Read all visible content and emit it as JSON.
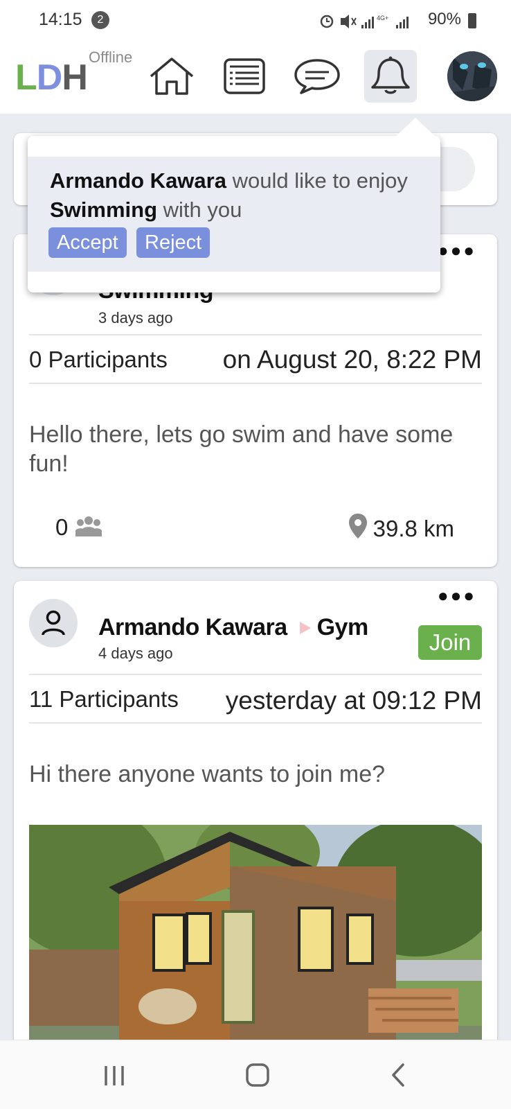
{
  "status_bar": {
    "time": "14:15",
    "notification_count": "2",
    "network": "4G+",
    "battery": "90%"
  },
  "header": {
    "logo": [
      "L",
      "D",
      "H"
    ],
    "connection_status": "Offline",
    "nav_icons": [
      "home-icon",
      "feed-icon",
      "chat-icon",
      "bell-icon"
    ],
    "active_nav": "bell-icon"
  },
  "notification": {
    "name": "Armando Kawara",
    "text_part1": "would like to enjoy",
    "activity": "Swimming",
    "text_part2": "with you",
    "accept_label": "Accept",
    "reject_label": "Reject"
  },
  "posts": [
    {
      "activity": "Swimming",
      "time_ago": "3 days ago",
      "participants": "0 Participants",
      "when": "on August 20, 8:22 PM",
      "body": "Hello there, lets go swim and have some fun!",
      "count": "0",
      "distance": "39.8 km"
    },
    {
      "author": "Armando Kawara",
      "activity": "Gym",
      "time_ago": "4 days ago",
      "join_label": "Join",
      "participants": "11 Participants",
      "when": "yesterday at 09:12 PM",
      "body": "Hi there anyone wants to join me?"
    }
  ],
  "colors": {
    "brand_green": "#6ab04c",
    "brand_blue": "#7e8fe0",
    "button_blue": "#7b90dc",
    "background": "#e9ecf1"
  }
}
